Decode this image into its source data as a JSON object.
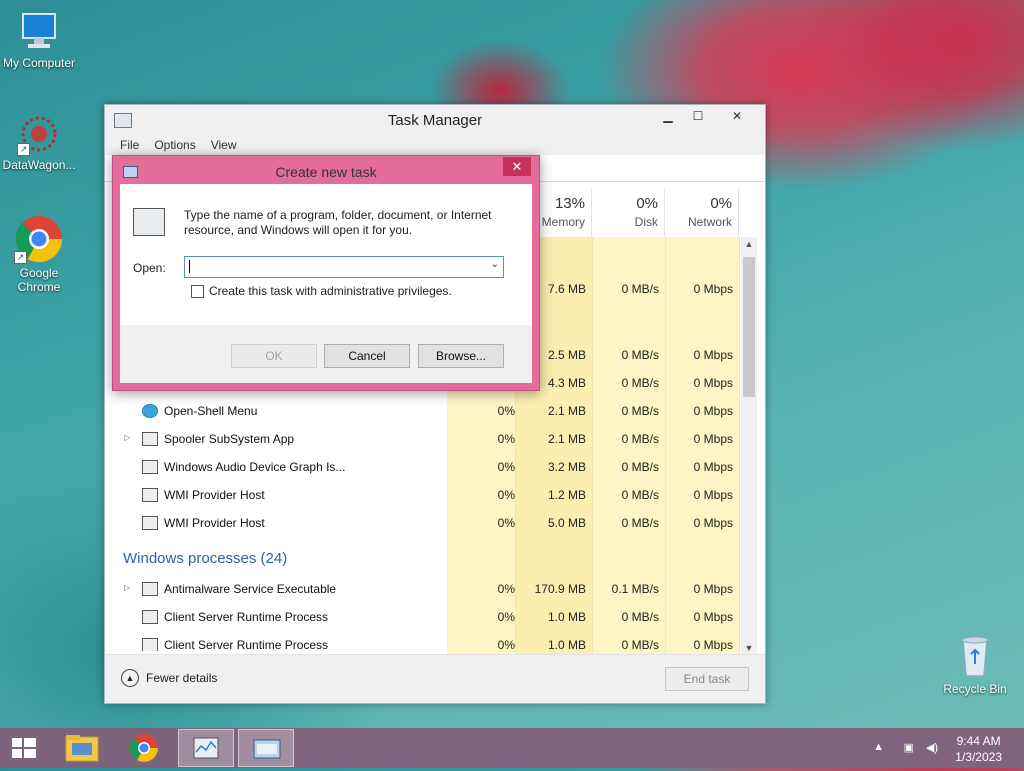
{
  "desktop": {
    "icons": [
      {
        "label": "My Computer"
      },
      {
        "label": "DataWagon..."
      },
      {
        "label": "Google Chrome"
      },
      {
        "label": "Recycle Bin"
      }
    ]
  },
  "task_manager": {
    "title": "Task Manager",
    "menu": [
      "File",
      "Options",
      "View"
    ],
    "columns": [
      {
        "pct": "13%",
        "label": "Memory"
      },
      {
        "pct": "0%",
        "label": "Disk"
      },
      {
        "pct": "0%",
        "label": "Network"
      }
    ],
    "rows_top": [
      {
        "memory": "7.6 MB",
        "disk": "0 MB/s",
        "network": "0 Mbps"
      },
      {
        "memory": "2.5 MB",
        "disk": "0 MB/s",
        "network": "0 Mbps"
      },
      {
        "memory": "4.3 MB",
        "disk": "0 MB/s",
        "network": "0 Mbps"
      }
    ],
    "rows": [
      {
        "name": "Open-Shell Menu",
        "cpu": "0%",
        "memory": "2.1 MB",
        "disk": "0 MB/s",
        "network": "0 Mbps",
        "expandable": false
      },
      {
        "name": "Spooler SubSystem App",
        "cpu": "0%",
        "memory": "2.1 MB",
        "disk": "0 MB/s",
        "network": "0 Mbps",
        "expandable": true
      },
      {
        "name": "Windows Audio Device Graph Is...",
        "cpu": "0%",
        "memory": "3.2 MB",
        "disk": "0 MB/s",
        "network": "0 Mbps",
        "expandable": false
      },
      {
        "name": "WMI Provider Host",
        "cpu": "0%",
        "memory": "1.2 MB",
        "disk": "0 MB/s",
        "network": "0 Mbps",
        "expandable": false
      },
      {
        "name": "WMI Provider Host",
        "cpu": "0%",
        "memory": "5.0 MB",
        "disk": "0 MB/s",
        "network": "0 Mbps",
        "expandable": false
      }
    ],
    "group_label": "Windows processes (24)",
    "rows_windows": [
      {
        "name": "Antimalware Service Executable",
        "cpu": "0%",
        "memory": "170.9 MB",
        "disk": "0.1 MB/s",
        "network": "0 Mbps",
        "expandable": true
      },
      {
        "name": "Client Server Runtime Process",
        "cpu": "0%",
        "memory": "1.0 MB",
        "disk": "0 MB/s",
        "network": "0 Mbps",
        "expandable": false
      },
      {
        "name": "Client Server Runtime Process",
        "cpu": "0%",
        "memory": "1.0 MB",
        "disk": "0 MB/s",
        "network": "0 Mbps",
        "expandable": false
      }
    ],
    "fewer_details": "Fewer details",
    "end_task": "End task"
  },
  "dialog": {
    "title": "Create new task",
    "close": "✕",
    "message": "Type the name of a program, folder, document, or Internet resource, and Windows will open it for you.",
    "open_label": "Open:",
    "open_value": "",
    "admin_checkbox": "Create this task with administrative privileges.",
    "ok": "OK",
    "cancel": "Cancel",
    "browse": "Browse..."
  },
  "taskbar": {
    "time": "9:44 AM",
    "date": "1/3/2023"
  },
  "colors": {
    "dialog_frame": "#e46c9a",
    "accent_blue": "#2a62b0",
    "column_highlight": "#fff4c4"
  }
}
